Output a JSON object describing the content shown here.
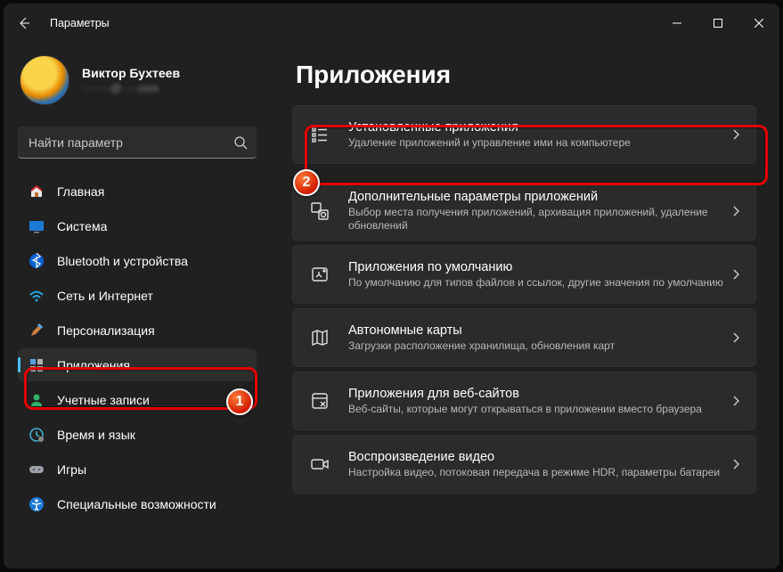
{
  "window": {
    "title": "Параметры"
  },
  "profile": {
    "name": "Виктор Бухтеев",
    "subtitle": "········@····.com"
  },
  "search": {
    "placeholder": "Найти параметр"
  },
  "nav": [
    {
      "id": "home",
      "label": "Главная",
      "icon": "home"
    },
    {
      "id": "system",
      "label": "Система",
      "icon": "system"
    },
    {
      "id": "bt",
      "label": "Bluetooth и устройства",
      "icon": "bluetooth"
    },
    {
      "id": "net",
      "label": "Сеть и Интернет",
      "icon": "wifi"
    },
    {
      "id": "pers",
      "label": "Персонализация",
      "icon": "brush"
    },
    {
      "id": "apps",
      "label": "Приложения",
      "icon": "apps",
      "selected": true
    },
    {
      "id": "acct",
      "label": "Учетные записи",
      "icon": "account"
    },
    {
      "id": "time",
      "label": "Время и язык",
      "icon": "clock"
    },
    {
      "id": "game",
      "label": "Игры",
      "icon": "game"
    },
    {
      "id": "a11y",
      "label": "Специальные возможности",
      "icon": "a11y"
    }
  ],
  "page": {
    "title": "Приложения"
  },
  "cards": [
    {
      "id": "installed",
      "title": "Установленные приложения",
      "sub": "Удаление приложений и управление ими на компьютере",
      "icon": "list"
    },
    {
      "id": "advanced",
      "title": "Дополнительные параметры приложений",
      "sub": "Выбор места получения приложений, архивация приложений, удаление обновлений",
      "icon": "gear"
    },
    {
      "id": "defaults",
      "title": "Приложения по умолчанию",
      "sub": "По умолчанию для типов файлов и ссылок, другие значения по умолчанию",
      "icon": "defaults"
    },
    {
      "id": "maps",
      "title": "Автономные карты",
      "sub": "Загрузки расположение хранилища, обновления карт",
      "icon": "map"
    },
    {
      "id": "websites",
      "title": "Приложения для веб-сайтов",
      "sub": "Веб-сайты, которые могут открываться в приложении вместо браузера",
      "icon": "web"
    },
    {
      "id": "video",
      "title": "Воспроизведение видео",
      "sub": "Настройка видео, потоковая передача в режиме HDR, параметры батареи",
      "icon": "video"
    }
  ],
  "annotations": {
    "badge1": "1",
    "badge2": "2"
  }
}
